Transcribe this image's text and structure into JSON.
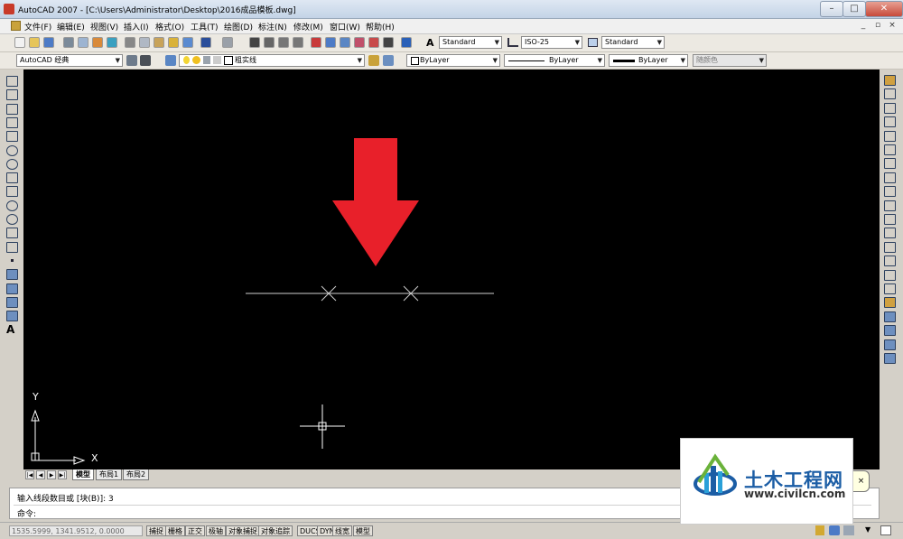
{
  "window": {
    "title": "AutoCAD 2007 - [C:\\Users\\Administrator\\Desktop\\2016成品模板.dwg]",
    "minimize": "–",
    "maximize": "□",
    "close": "✕",
    "mdi_minimize": "_",
    "mdi_restore": "▫",
    "mdi_close": "×"
  },
  "menu": [
    "文件(F)",
    "编辑(E)",
    "视图(V)",
    "插入(I)",
    "格式(O)",
    "工具(T)",
    "绘图(D)",
    "标注(N)",
    "修改(M)",
    "窗口(W)",
    "帮助(H)"
  ],
  "styles": {
    "text_style": "Standard",
    "dim_style": "ISO-25",
    "table_style": "Standard"
  },
  "workspace": "AutoCAD 经典",
  "layer": "粗实线",
  "properties": {
    "color": "ByLayer",
    "linetype": "ByLayer",
    "lineweight": "ByLayer",
    "plotstyle": "随颜色"
  },
  "ucs": {
    "x_label": "X",
    "y_label": "Y"
  },
  "layout_tabs": [
    "模型",
    "布局1",
    "布局2"
  ],
  "nav_glyphs": [
    "|◀",
    "◀",
    "▶",
    "▶|"
  ],
  "command": {
    "history": "输入线段数目或 [块(B)]: 3",
    "prompt": "命令:"
  },
  "status": {
    "coords": "1535.5999, 1341.9512, 0.0000",
    "buttons": [
      "捕捉",
      "栅格",
      "正交",
      "极轴",
      "对象捕捉",
      "对象追踪",
      "DUCS",
      "DYN",
      "线宽",
      "模型"
    ]
  },
  "watermark": {
    "title": "土木工程网",
    "url": "www.civilcn.com"
  },
  "tooltip_close": "×",
  "colors": {
    "canvas": "#000000",
    "arrow": "#e8202a",
    "drawing_line": "#cfcfcf",
    "brand_blue": "#1b5da5"
  }
}
